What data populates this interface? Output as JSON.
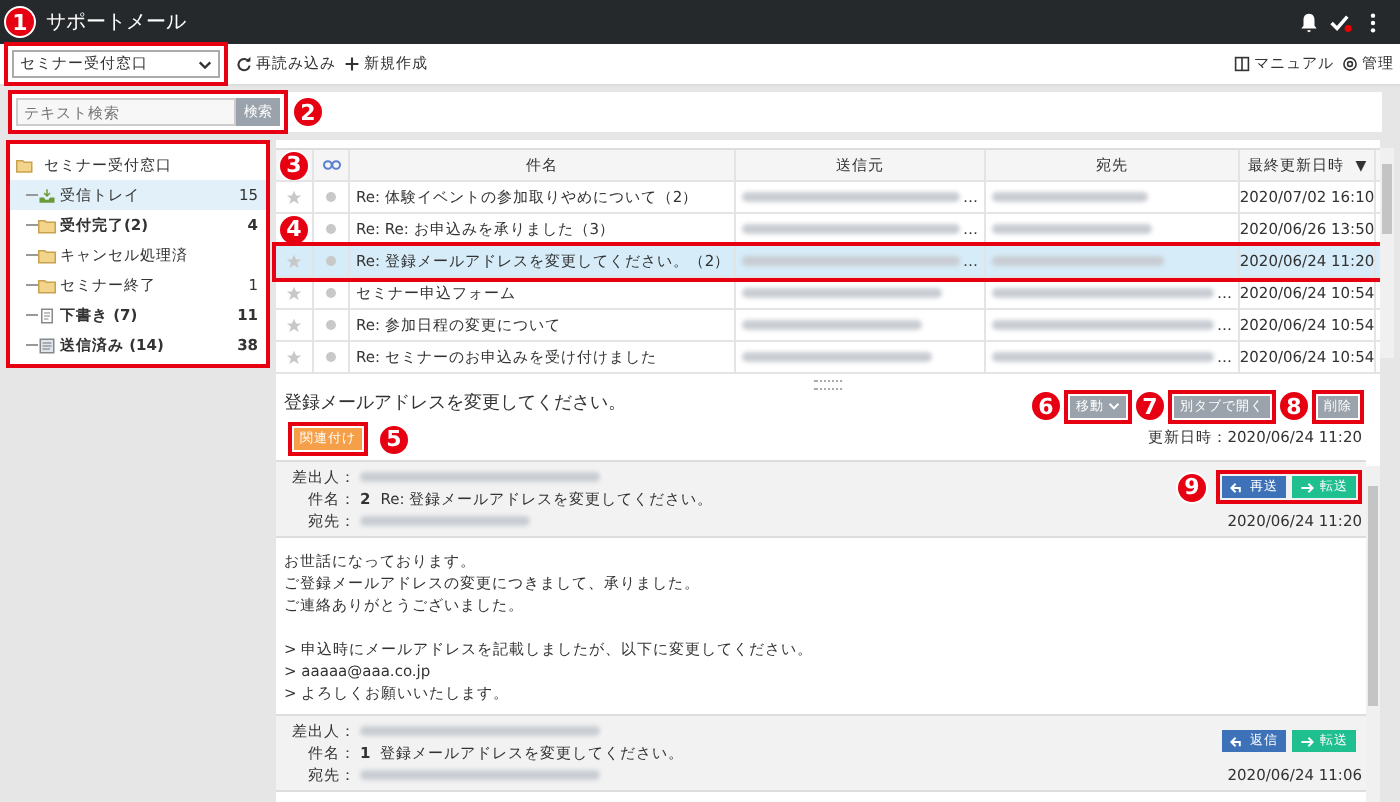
{
  "app_bar": {
    "callout": "1",
    "title": "サポートメール",
    "has_notification_dot": true
  },
  "toolbar": {
    "mailbox_select": "セミナー受付窓口",
    "highlighted": true,
    "actions": [
      "再読み込み",
      "新規作成"
    ],
    "links": [
      "マニュアル",
      "管理"
    ]
  },
  "search": {
    "placeholder": "テキスト検索",
    "button": "検索",
    "highlighted": true,
    "callout": "2"
  },
  "tree": {
    "label": "セミナー受付窓口",
    "highlighted": true,
    "children": [
      {
        "kind": "inbox",
        "label": "受信トレイ",
        "count": "15",
        "bold": false,
        "selected": true
      },
      {
        "kind": "folder",
        "label": "受付完了(2)",
        "count": "4",
        "bold": true,
        "selected": false
      },
      {
        "kind": "folder",
        "label": "キャンセル処理済",
        "bold": false,
        "selected": false
      },
      {
        "kind": "folder",
        "label": "セミナー終了",
        "count": "1",
        "bold": false,
        "selected": false
      },
      {
        "kind": "draft",
        "label": "下書き (7)",
        "count": "11",
        "bold": true,
        "selected": false
      },
      {
        "kind": "sent",
        "label": "送信済み (14)",
        "count": "38",
        "bold": true,
        "selected": false
      }
    ]
  },
  "table": {
    "header_callout": "3",
    "columns": [
      "件名",
      "送信元",
      "宛先",
      "最終更新日時"
    ],
    "sort_mark": "▼",
    "rows": [
      {
        "subject": "Re: 体験イベントの参加取りやめについて（2）",
        "sender_cut": "…",
        "date": "2020/07/02 16:10",
        "selected": false,
        "highlighted": false
      },
      {
        "callout": "4",
        "subject": "Re: Re: お申込みを承りました（3）",
        "sender_cut": "…",
        "date": "2020/06/26 13:50",
        "selected": false,
        "highlighted": false
      },
      {
        "subject": "Re: 登録メールアドレスを変更してください。（2）",
        "sender_cut": "…",
        "date": "2020/06/24 11:20",
        "selected": true,
        "highlighted": true
      },
      {
        "subject": "セミナー申込フォーム",
        "recipient_cut": "…",
        "date": "2020/06/24 10:54",
        "selected": false,
        "highlighted": false
      },
      {
        "subject": "Re: 参加日程の変更について",
        "recipient_cut": "…",
        "date": "2020/06/24 10:54",
        "selected": false,
        "highlighted": false
      },
      {
        "subject": "Re: セミナーのお申込みを受け付けました",
        "recipient_cut": "…",
        "date": "2020/06/24 10:54",
        "selected": false,
        "highlighted": false
      }
    ]
  },
  "detail": {
    "title": "登録メールアドレスを変更してください。",
    "link_button": "関連付け",
    "link_highlighted": true,
    "link_callout": "5",
    "actions": [
      {
        "callout": "6",
        "label": "移動",
        "menu": true
      },
      {
        "callout": "7",
        "label": "別タブで開く",
        "menu": false
      },
      {
        "callout": "8",
        "label": "削除",
        "menu": false
      }
    ],
    "updated": "更新日時：2020/06/24 11:20",
    "messages": [
      {
        "from_label": "差出人：",
        "subject_label": "件名：",
        "number": "2",
        "subject": "Re: 登録メールアドレスを変更してください。",
        "to_label": "宛先：",
        "callout": "9",
        "buttons_highlighted": true,
        "buttons": [
          {
            "kind": "reply",
            "label": "再送"
          },
          {
            "kind": "forward",
            "label": "転送"
          }
        ],
        "date": "2020/06/24 11:20",
        "body": [
          [
            "お世話になっております。",
            "ご登録メールアドレスの変更につきまして、承りました。",
            "ご連絡ありがとうございました。"
          ],
          [
            "> 申込時にメールアドレスを記載しましたが、以下に変更してください。",
            "> aaaaa@aaa.co.jp",
            "> よろしくお願いいたします。"
          ]
        ]
      },
      {
        "from_label": "差出人：",
        "subject_label": "件名：",
        "number": "1",
        "subject": "登録メールアドレスを変更してください。",
        "to_label": "宛先：",
        "buttons_highlighted": false,
        "buttons": [
          {
            "kind": "reply",
            "label": "返信"
          },
          {
            "kind": "forward",
            "label": "転送"
          }
        ],
        "date": "2020/06/24 11:06"
      }
    ]
  }
}
